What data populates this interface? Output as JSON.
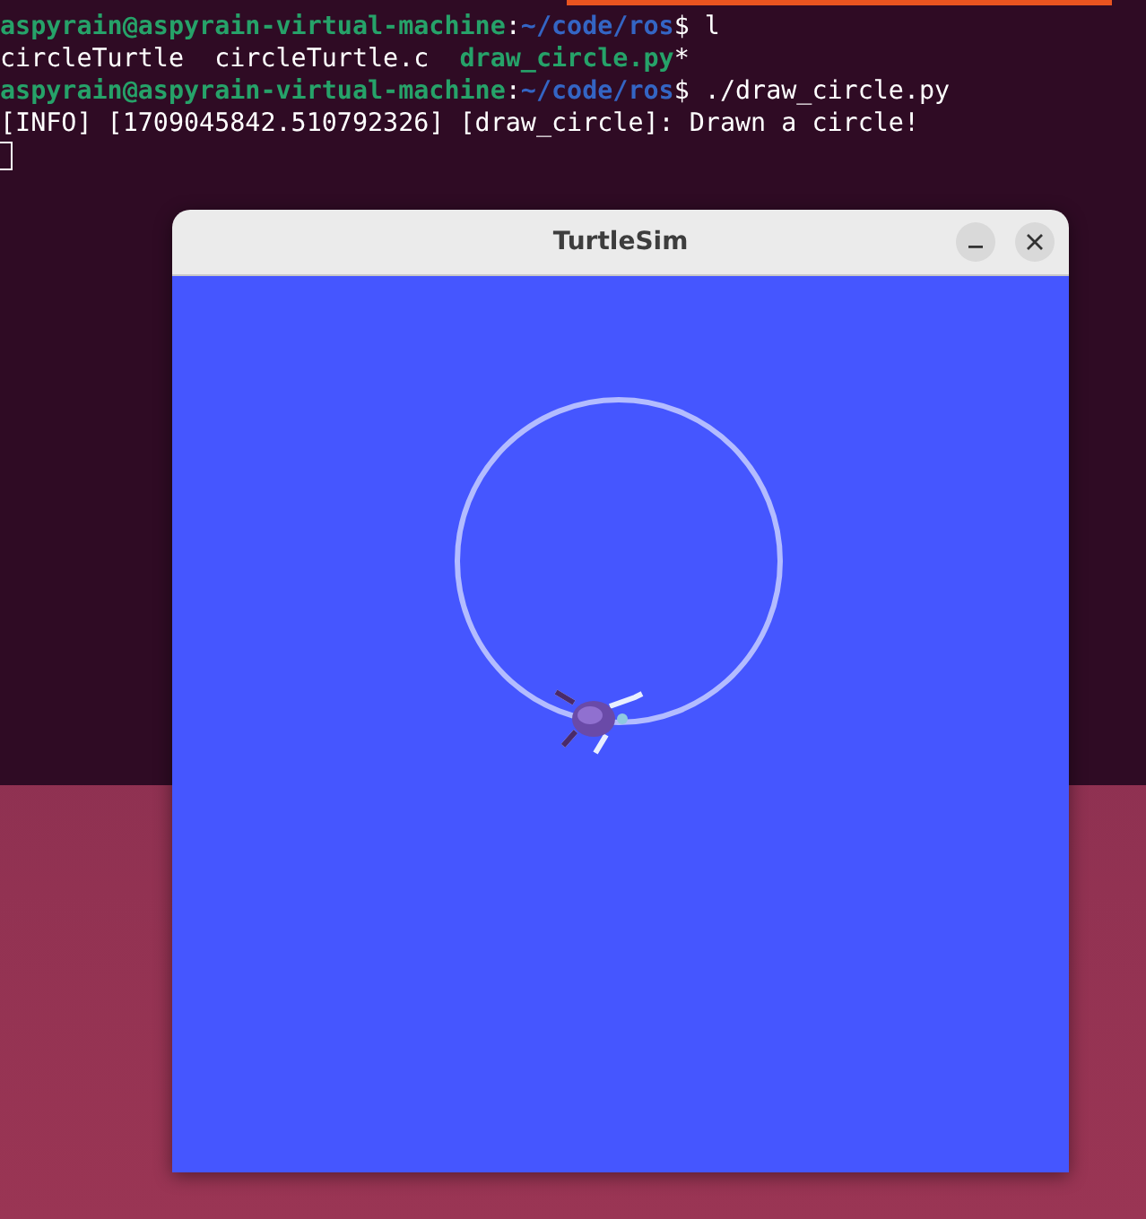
{
  "terminal": {
    "lines": [
      {
        "segments": [
          {
            "kind": "user",
            "text": "aspyrain@aspyrain-virtual-machine"
          },
          {
            "kind": "plain",
            "text": ":"
          },
          {
            "kind": "path",
            "text": "~/code/ros"
          },
          {
            "kind": "plain",
            "text": "$ l"
          }
        ]
      },
      {
        "segments": [
          {
            "kind": "plain",
            "text": "circleTurtle  circleTurtle.c  "
          },
          {
            "kind": "exec",
            "text": "draw_circle.py"
          },
          {
            "kind": "plain",
            "text": "*"
          }
        ]
      },
      {
        "segments": [
          {
            "kind": "user",
            "text": "aspyrain@aspyrain-virtual-machine"
          },
          {
            "kind": "plain",
            "text": ":"
          },
          {
            "kind": "path",
            "text": "~/code/ros"
          },
          {
            "kind": "plain",
            "text": "$ ./draw_circle.py"
          }
        ]
      },
      {
        "segments": [
          {
            "kind": "plain",
            "text": "[INFO] [1709045842.510792326] [draw_circle]: Drawn a circle!"
          }
        ]
      }
    ]
  },
  "window": {
    "title": "TurtleSim"
  }
}
